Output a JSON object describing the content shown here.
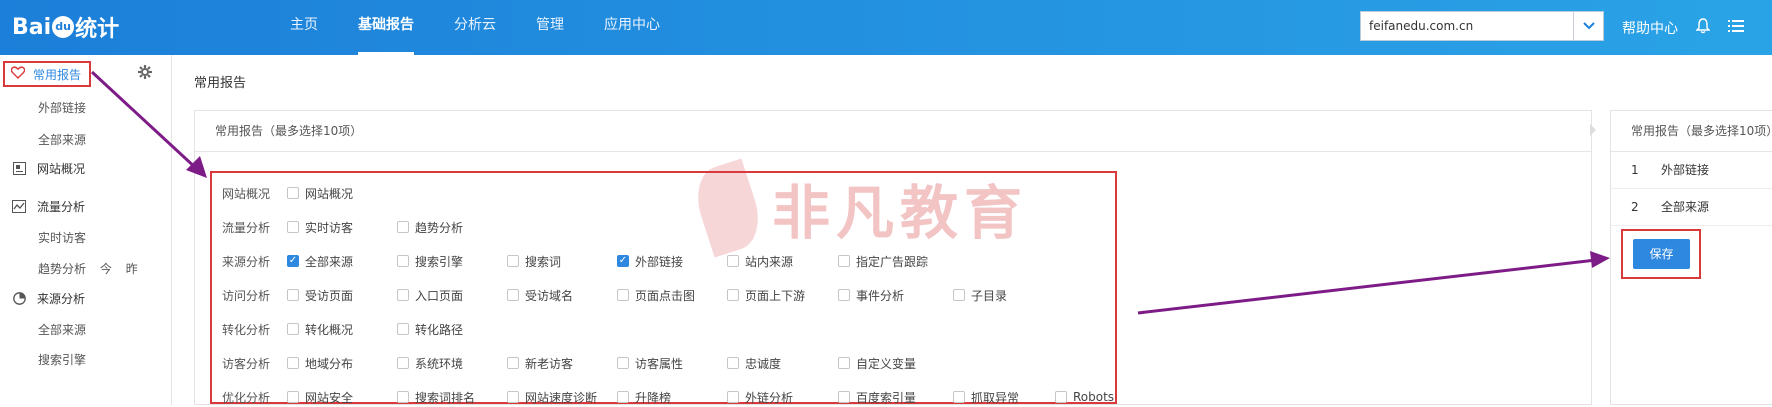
{
  "brand": {
    "logo_text_a": "Bai",
    "logo_paw": "du",
    "logo_text_b": "统计"
  },
  "nav": {
    "items": [
      "主页",
      "基础报告",
      "分析云",
      "管理",
      "应用中心"
    ],
    "active_index": 1
  },
  "site_select": {
    "value": "feifanedu.com.cn",
    "icon": "chevron-down-icon"
  },
  "top_right": {
    "help": "帮助中心",
    "bell_icon": "bell-icon",
    "list_icon": "list-icon"
  },
  "sidebar": {
    "favorites": {
      "label": "常用报告",
      "icon": "heart-icon"
    },
    "fav_subs": [
      "外部链接",
      "全部来源"
    ],
    "sections": [
      {
        "label": "网站概况",
        "icon": "overview-icon"
      },
      {
        "label": "流量分析",
        "icon": "trend-icon"
      },
      {
        "label": "来源分析",
        "icon": "pie-icon"
      }
    ],
    "traffic_subs": [
      "实时访客",
      "趋势分析"
    ],
    "trend_extra": [
      "今",
      "昨"
    ],
    "source_subs": [
      "全部来源",
      "搜索引擎"
    ]
  },
  "main": {
    "title": "常用报告",
    "panel_title": "常用报告（最多选择10项）",
    "rows": [
      {
        "category": "网站概况",
        "options": [
          {
            "label": "网站概况",
            "checked": false
          }
        ]
      },
      {
        "category": "流量分析",
        "options": [
          {
            "label": "实时访客",
            "checked": false
          },
          {
            "label": "趋势分析",
            "checked": false
          }
        ]
      },
      {
        "category": "来源分析",
        "options": [
          {
            "label": "全部来源",
            "checked": true
          },
          {
            "label": "搜索引擎",
            "checked": false
          },
          {
            "label": "搜索词",
            "checked": false
          },
          {
            "label": "外部链接",
            "checked": true
          },
          {
            "label": "站内来源",
            "checked": false
          },
          {
            "label": "指定广告跟踪",
            "checked": false
          }
        ]
      },
      {
        "category": "访问分析",
        "options": [
          {
            "label": "受访页面",
            "checked": false
          },
          {
            "label": "入口页面",
            "checked": false
          },
          {
            "label": "受访域名",
            "checked": false
          },
          {
            "label": "页面点击图",
            "checked": false
          },
          {
            "label": "页面上下游",
            "checked": false
          },
          {
            "label": "事件分析",
            "checked": false
          },
          {
            "label": "子目录",
            "checked": false
          }
        ]
      },
      {
        "category": "转化分析",
        "options": [
          {
            "label": "转化概况",
            "checked": false
          },
          {
            "label": "转化路径",
            "checked": false
          }
        ]
      },
      {
        "category": "访客分析",
        "options": [
          {
            "label": "地域分布",
            "checked": false
          },
          {
            "label": "系统环境",
            "checked": false
          },
          {
            "label": "新老访客",
            "checked": false
          },
          {
            "label": "访客属性",
            "checked": false
          },
          {
            "label": "忠诚度",
            "checked": false
          },
          {
            "label": "自定义变量",
            "checked": false
          }
        ]
      },
      {
        "category": "优化分析",
        "options": [
          {
            "label": "网站安全",
            "checked": false
          },
          {
            "label": "搜索词排名",
            "checked": false
          },
          {
            "label": "网站速度诊断",
            "checked": false
          },
          {
            "label": "升降榜",
            "checked": false
          },
          {
            "label": "外链分析",
            "checked": false
          },
          {
            "label": "百度索引量",
            "checked": false
          },
          {
            "label": "抓取异常",
            "checked": false
          },
          {
            "label": "Robots",
            "checked": false
          }
        ]
      }
    ],
    "watermark": "非凡教育"
  },
  "right_panel": {
    "title": "常用报告（最多选择10项）",
    "items": [
      {
        "num": "1",
        "label": "外部链接"
      },
      {
        "num": "2",
        "label": "全部来源"
      }
    ],
    "save_label": "保存"
  },
  "colors": {
    "accent": "#2f88e0",
    "highlight": "#d9393b",
    "arrow": "#7d1c87",
    "topbar": "#1c7fd9"
  }
}
